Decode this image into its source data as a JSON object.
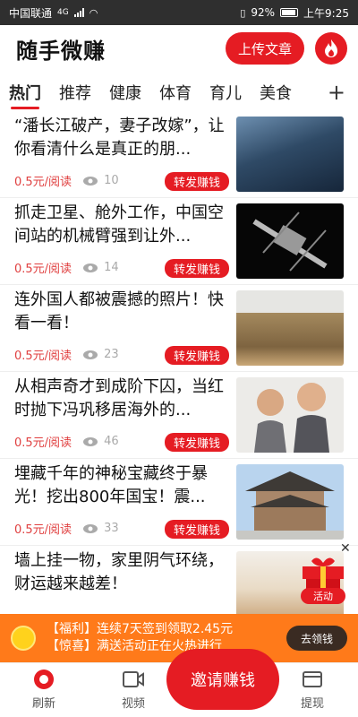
{
  "status_bar": {
    "carrier": "中国联通",
    "network": "4G",
    "battery": "92%",
    "time": "上午9:25"
  },
  "header": {
    "title": "随手微赚",
    "upload_label": "上传文章",
    "fire_icon": "fire-icon"
  },
  "tabs": [
    "热门",
    "推荐",
    "健康",
    "体育",
    "育儿",
    "美食"
  ],
  "tab_add_label": "+",
  "feed": [
    {
      "title": "“潘长江破产，妻子改嫁”，让你看清什么是真正的朋...",
      "price": "0.5元/阅读",
      "views": "10",
      "share": "转发赚钱"
    },
    {
      "title": "抓走卫星、舱外工作，中国空间站的机械臂强到让外...",
      "price": "0.5元/阅读",
      "views": "14",
      "share": "转发赚钱"
    },
    {
      "title": "连外国人都被震撼的照片！快看一看！",
      "price": "0.5元/阅读",
      "views": "23",
      "share": "转发赚钱"
    },
    {
      "title": "从相声奇才到成阶下囚，当红时抛下冯巩移居海外的...",
      "price": "0.5元/阅读",
      "views": "46",
      "share": "转发赚钱"
    },
    {
      "title": "埋藏千年的神秘宝藏终于暴光！挖出800年国宝！震...",
      "price": "0.5元/阅读",
      "views": "33",
      "share": "转发赚钱"
    },
    {
      "title": "墙上挂一物，家里阴气环绕，财运越来越差！",
      "price": "",
      "views": "",
      "share": ""
    }
  ],
  "promo": {
    "line1": "【福利】连续7天签到领取2.45元",
    "line2": "【惊喜】满送活动正在火热进行",
    "button": "去领钱",
    "gift_label": "活动",
    "close": "✕"
  },
  "bottom_nav": {
    "refresh": "刷新",
    "video": "视频",
    "invite": "邀请赚钱",
    "withdraw": "提现"
  },
  "colors": {
    "accent": "#e51c23",
    "banner": "#ff7a1a"
  }
}
